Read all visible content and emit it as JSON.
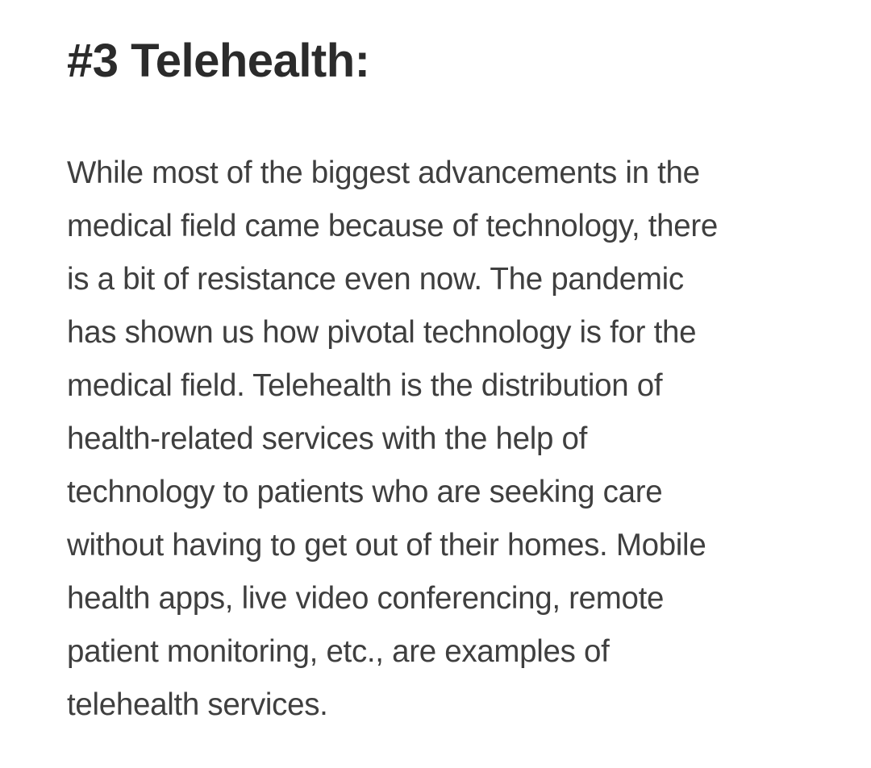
{
  "article": {
    "heading": "#3 Telehealth:",
    "body": " While most of the biggest advancements in the\nmedical field came because of technology, there\nis a bit of resistance even now. The pandemic\nhas shown us how pivotal technology is for the\nmedical field. Telehealth is the distribution of\nhealth-related services with the help of\ntechnology to patients who are seeking care\nwithout having to get out of their homes. Mobile\nhealth apps, live video conferencing, remote\npatient monitoring, etc., are examples of\ntelehealth services."
  }
}
